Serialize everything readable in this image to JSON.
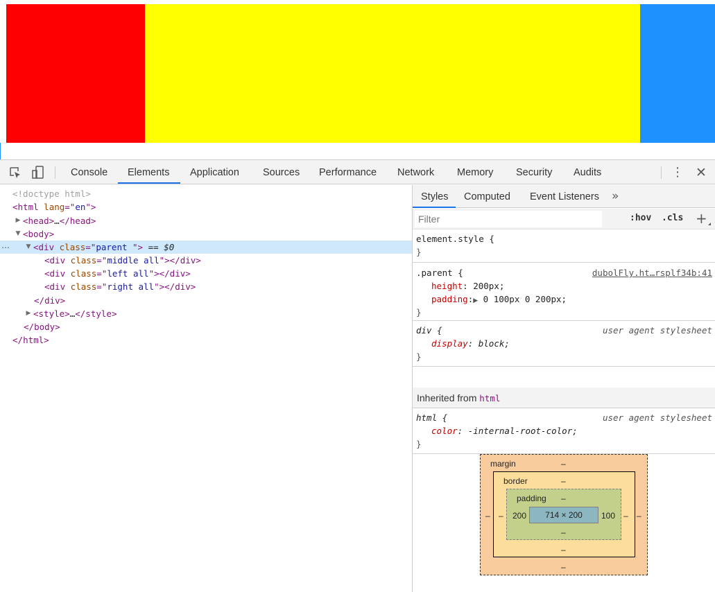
{
  "page": {
    "colors": {
      "left": "#ff0000",
      "middle": "#ffff00",
      "right": "#1e90ff"
    }
  },
  "devtools": {
    "tabs": [
      "Console",
      "Elements",
      "Application",
      "Sources",
      "Performance",
      "Network",
      "Memory",
      "Security",
      "Audits"
    ],
    "active_tab": "Elements",
    "icons": [
      "inspect-element-icon",
      "device-toolbar-icon",
      "more-options-icon",
      "close-icon"
    ],
    "dom": {
      "doctype": "<!doctype html>",
      "html_tag": "html",
      "html_attr": "lang",
      "html_val": "en",
      "head_tag": "head",
      "collapsed": "…",
      "body_tag": "body",
      "div_tag": "div",
      "class_attr": "class",
      "parent_val": "parent ",
      "selected_suffix": " == $0",
      "middle_val": "middle all",
      "left_val": "left all",
      "right_val": "right all",
      "style_tag": "style",
      "selected_marker": "…"
    },
    "styles_panel": {
      "tabs": [
        "Styles",
        "Computed",
        "Event Listeners"
      ],
      "active_tab": "Styles",
      "more_tabs": "»",
      "filter_placeholder": "Filter",
      "hov": ":hov",
      "cls": ".cls",
      "add": "+",
      "rules": {
        "element_style": "element.style {",
        "close": "}",
        "parent_selector": ".parent {",
        "parent_source": "dubolFly.ht…rsplf34b:41",
        "height_prop": "height",
        "height_val": "200px;",
        "padding_prop": "padding",
        "padding_val": "0 100px 0 200px;",
        "div_selector": "div {",
        "ua_label": "user agent stylesheet",
        "display_prop": "display",
        "display_val": "block;",
        "html_selector": "html {",
        "color_prop": "color",
        "color_val": "-internal-root-color;"
      },
      "inherited_label": "Inherited from",
      "inherited_tag": "html",
      "box_model": {
        "margin_label": "margin",
        "border_label": "border",
        "padding_label": "padding",
        "dash": "–",
        "padding_left": "200",
        "padding_right": "100",
        "content": "714 × 200"
      }
    }
  }
}
